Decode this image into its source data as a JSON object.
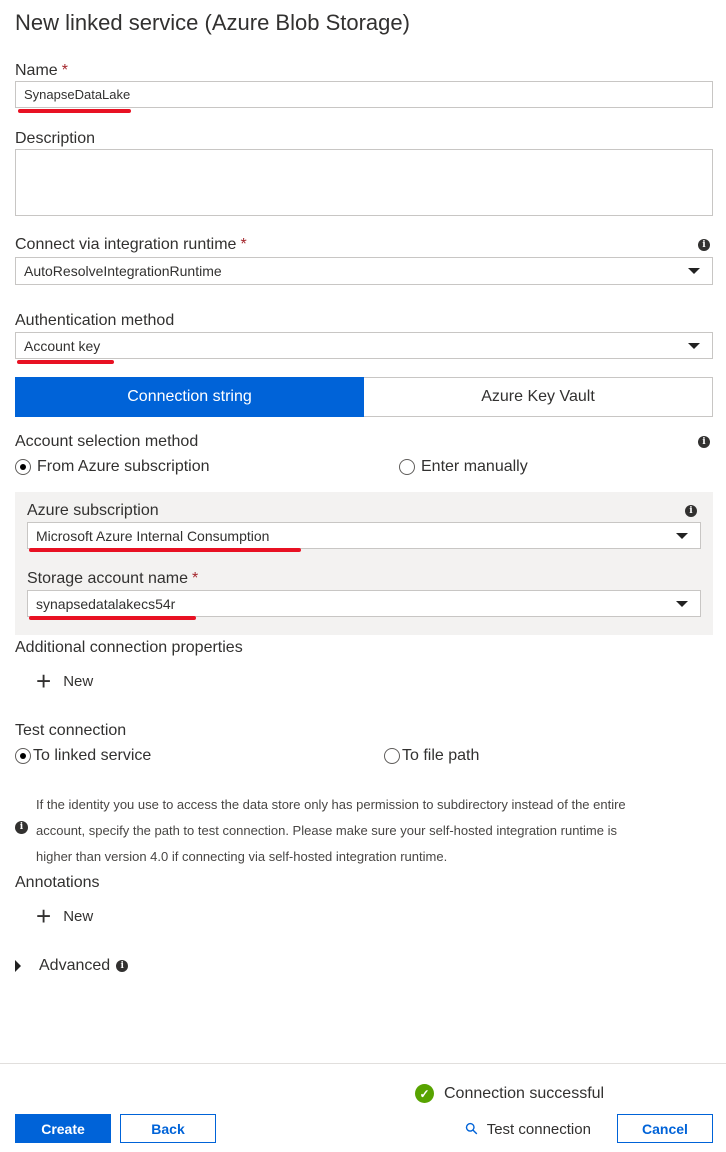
{
  "title": "New linked service (Azure Blob Storage)",
  "name": {
    "label": "Name",
    "required": "*",
    "value": "SynapseDataLake"
  },
  "description": {
    "label": "Description",
    "value": ""
  },
  "runtime": {
    "label": "Connect via integration runtime",
    "required": "*",
    "value": "AutoResolveIntegrationRuntime"
  },
  "auth": {
    "label": "Authentication method",
    "value": "Account key"
  },
  "tabs": [
    {
      "label": "Connection string",
      "active": true
    },
    {
      "label": "Azure Key Vault",
      "active": false
    }
  ],
  "account_selection": {
    "label": "Account selection method",
    "options": [
      "From Azure subscription",
      "Enter manually"
    ],
    "selected": "From Azure subscription"
  },
  "subscription": {
    "label": "Azure subscription",
    "value": "Microsoft Azure Internal Consumption"
  },
  "storage": {
    "label": "Storage account name",
    "required": "*",
    "value": "synapsedatalakecs54r"
  },
  "additional": {
    "label": "Additional connection properties",
    "new": "New"
  },
  "test": {
    "label": "Test connection",
    "options": [
      "To linked service",
      "To file path"
    ],
    "selected": "To linked service",
    "note": [
      "If the identity you use to access the data store only has permission to subdirectory instead of the entire",
      "account, specify the path to test connection. Please make sure your self-hosted integration runtime is",
      "higher than version 4.0 if connecting via self-hosted integration runtime."
    ]
  },
  "annotations": {
    "label": "Annotations",
    "new": "New"
  },
  "advanced": {
    "label": "Advanced"
  },
  "status": {
    "text": "Connection successful",
    "color": "#57a300"
  },
  "footer": {
    "create": "Create",
    "back": "Back",
    "test": "Test connection",
    "cancel": "Cancel"
  },
  "colors": {
    "accent": "#0063d8",
    "annotation_underline": "#e81123"
  }
}
